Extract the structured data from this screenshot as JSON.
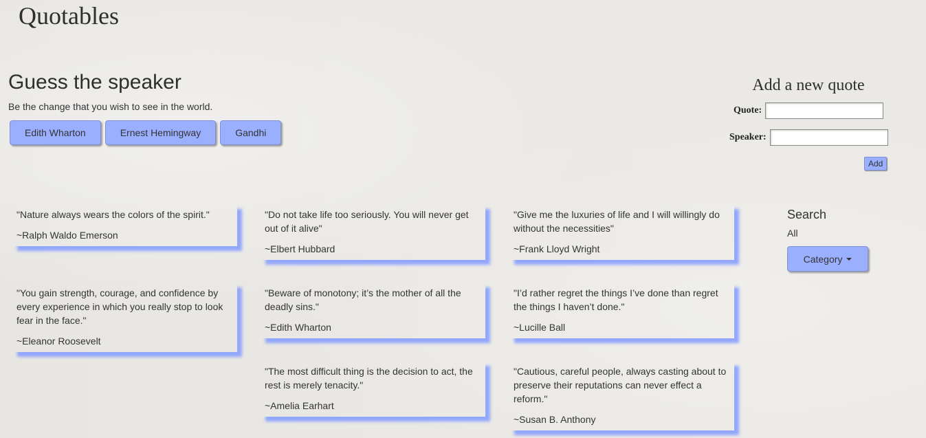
{
  "site_title": "Quotables",
  "guess": {
    "title": "Guess the speaker",
    "quote": "Be the change that you wish to see in the world.",
    "choices": [
      "Edith Wharton",
      "Ernest Hemingway",
      "Gandhi"
    ]
  },
  "add_form": {
    "title": "Add a new quote",
    "quote_label": "Quote:",
    "quote_value": "",
    "speaker_label": "Speaker:",
    "speaker_value": "",
    "add_label": "Add"
  },
  "quotes": [
    {
      "text": "\"Nature always wears the colors of the spirit.\"",
      "speaker": "~Ralph Waldo Emerson"
    },
    {
      "text": "\"Do not take life too seriously. You will never get out of it alive\"",
      "speaker": "~Elbert Hubbard"
    },
    {
      "text": "\"Give me the luxuries of life and I will willingly do without the necessities\"",
      "speaker": "~Frank Lloyd Wright"
    },
    {
      "text": "\"You gain strength, courage, and confidence by every experience in which you really stop to look fear in the face.\"",
      "speaker": "~Eleanor Roosevelt"
    },
    {
      "text": "\"Beware of monotony; it’s the mother of all the deadly sins.\"",
      "speaker": "~Edith Wharton"
    },
    {
      "text": "\"I’d rather regret the things I’ve done than regret the things I haven’t done.\"",
      "speaker": "~Lucille Ball"
    },
    {
      "text": "\"The most difficult thing is the decision to act, the rest is merely tenacity.\"",
      "speaker": "~Amelia Earhart"
    },
    {
      "text": "\"Cautious, careful people, always casting about to preserve their reputations can never effect a reform.\"",
      "speaker": "~Susan B. Anthony"
    }
  ],
  "search": {
    "title": "Search",
    "filter": "All",
    "category_label": "Category",
    "category_icon": "caret-down-icon"
  },
  "colors": {
    "accent": "#9bafff",
    "background": "#ebe9e5"
  }
}
